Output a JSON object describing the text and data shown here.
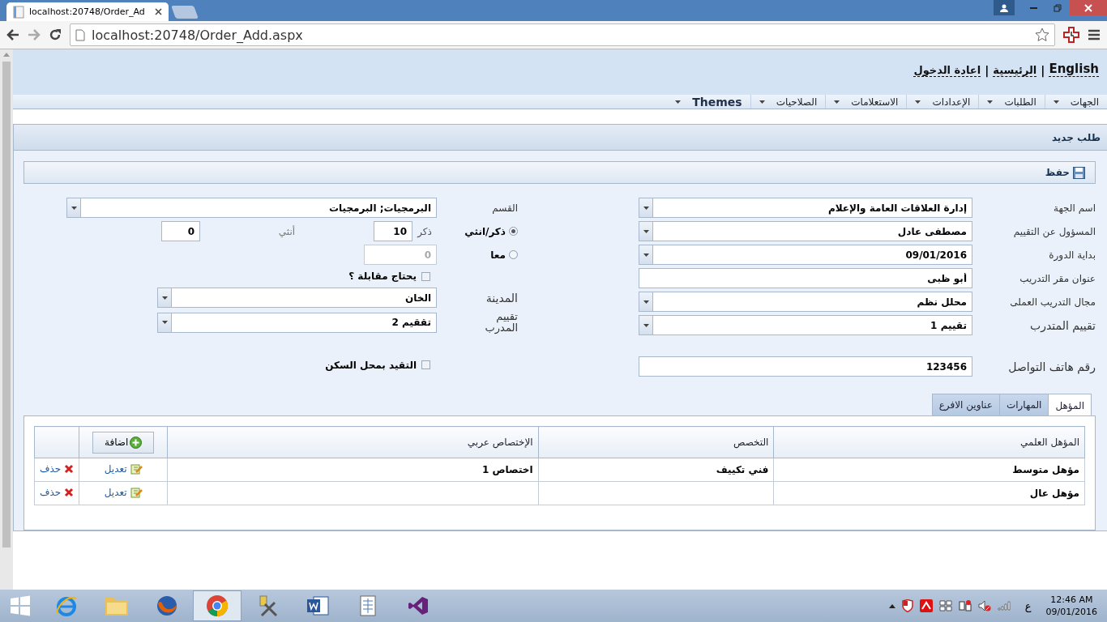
{
  "browser": {
    "tab_title": "localhost:20748/Order_Ad",
    "url": "localhost:20748/Order_Add.aspx"
  },
  "header_links": [
    {
      "kind": "link",
      "label": "English"
    },
    {
      "kind": "separator",
      "label": "|"
    },
    {
      "kind": "link",
      "label": "الرئيسية"
    },
    {
      "kind": "separator",
      "label": "|"
    },
    {
      "kind": "link",
      "label": "اعادة الدخول"
    }
  ],
  "menu": [
    {
      "label": "الجهات",
      "emphasized": false
    },
    {
      "label": "الطلبات",
      "emphasized": false
    },
    {
      "label": "الإعدادات",
      "emphasized": false
    },
    {
      "label": "الاستعلامات",
      "emphasized": false
    },
    {
      "label": "الصلاحيات",
      "emphasized": false
    },
    {
      "label": "Themes",
      "emphasized": true
    }
  ],
  "panel": {
    "title": "طلب جديد",
    "save_label": "حفظ"
  },
  "form_right": [
    {
      "kind": "dropdown",
      "label": "اسم الجهة",
      "value": "إدارة العلاقات العامة والإعلام",
      "large_label": false
    },
    {
      "kind": "dropdown",
      "label": "المسؤول عن التقييم",
      "value": "مصطفى عادل",
      "large_label": false
    },
    {
      "kind": "dropdown",
      "label": "بداية الدورة",
      "value": "09/01/2016",
      "large_label": false
    },
    {
      "kind": "text",
      "label": "عنوان مقر التدريب",
      "value": "أبو ظبى",
      "large_label": false
    },
    {
      "kind": "dropdown",
      "label": "مجال التدريب العملى",
      "value": "محلل نظم",
      "large_label": false
    },
    {
      "kind": "dropdown",
      "label": "تقييم المتدرب",
      "value": "تقييم 1",
      "large_label": true
    }
  ],
  "contact_phone": {
    "label": "رقم هاتف التواصل",
    "value": "123456"
  },
  "section": {
    "label": "القسم",
    "value": "البرمجيات; البرمجيات"
  },
  "gender_mode": [
    {
      "label": "ذكر/انثي",
      "selected": true
    },
    {
      "label": "معا",
      "selected": false
    }
  ],
  "male": {
    "label": "ذكر",
    "value": "10"
  },
  "female": {
    "label": "أنثي",
    "value": "0"
  },
  "together": {
    "value": "0",
    "disabled": true
  },
  "needs_interview": {
    "label": "يحتاج مقابلة ؟",
    "checked": false
  },
  "city": {
    "label": "المدينة",
    "value": "الخان"
  },
  "trainer_rating": {
    "label": "تقييم المدرب",
    "value": "تققيم 2"
  },
  "residence_restriction": {
    "label": "التقيد بمحل السكن",
    "checked": false
  },
  "tabs": [
    {
      "label": "المؤهل",
      "selected": true
    },
    {
      "label": "المهارات",
      "selected": false
    },
    {
      "label": "عناوين الافرع",
      "selected": false
    }
  ],
  "table": {
    "columns": [
      "المؤهل العلمي",
      "التخصص",
      "الإختصاص عربي"
    ],
    "add_label": "اضافة",
    "rows": [
      {
        "cells": [
          "مؤهل متوسط",
          "فني تكييف",
          "اختصاص 1"
        ],
        "edit": "تعديل",
        "delete": "حذف"
      },
      {
        "cells": [
          "مؤهل عال"
        ],
        "edit": "تعديل",
        "delete": "حذف"
      }
    ]
  },
  "taskbar": {
    "apps": [
      {
        "kind": "browser-e",
        "active": false
      },
      {
        "kind": "folder",
        "active": false
      },
      {
        "kind": "fox",
        "active": false
      },
      {
        "kind": "chrome",
        "active": true
      },
      {
        "kind": "tool",
        "active": false
      },
      {
        "kind": "word",
        "active": false
      },
      {
        "kind": "sheet",
        "active": false
      },
      {
        "kind": "studio",
        "active": false
      }
    ],
    "keyboard": "ع",
    "time": "12:46 AM",
    "date": "09/01/2016"
  }
}
